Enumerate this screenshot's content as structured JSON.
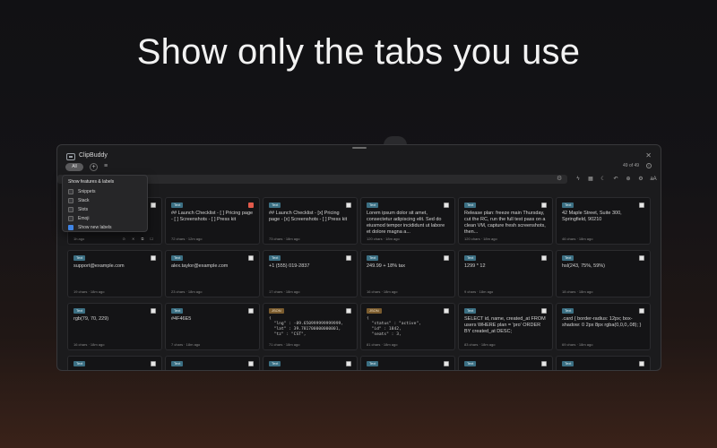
{
  "headline": "Show only the tabs you use",
  "app": {
    "title": "ClipBuddy",
    "filter_label": "All",
    "count": "49 of 49"
  },
  "dropdown": {
    "title": "Show features & labels",
    "items": [
      {
        "label": "Snippets",
        "checked": false
      },
      {
        "label": "Stack",
        "checked": false
      },
      {
        "label": "Slots",
        "checked": false
      },
      {
        "label": "Emoji",
        "checked": false
      },
      {
        "label": "Show new labels",
        "checked": true
      }
    ]
  },
  "cards": [
    {
      "tag": "Text",
      "body": "",
      "meta": "1h ago",
      "check": "white",
      "mono": false,
      "tools": "⊙ ✕ ⧉ ☐"
    },
    {
      "tag": "Text",
      "body": "## Launch Checklist - [ ] Pricing page - [ ] Screenshots - [ ] Press kit",
      "meta": "72 chars · 12m ago",
      "check": "red",
      "mono": false
    },
    {
      "tag": "Text",
      "body": "## Launch Checklist - [x] Pricing page - [x] Screenshots - [ ] Press kit",
      "meta": "73 chars · 18m ago",
      "check": "white",
      "mono": false
    },
    {
      "tag": "Text",
      "body": "Lorem ipsum dolor sit amet, consectetur adipiscing elit. Sed do eiusmod tempor incididunt ut labore et dolore magna a...",
      "meta": "120 chars · 18m ago",
      "check": "white",
      "mono": false
    },
    {
      "tag": "Text",
      "body": "Release plan: freeze main Thursday, cut the RC, run the full test pass on a clean VM, capture fresh screenshots, then...",
      "meta": "120 chars · 18m ago",
      "check": "white",
      "mono": false
    },
    {
      "tag": "Text",
      "body": "42 Maple Street, Suite 300, Springfield, 90210",
      "meta": "46 chars · 18m ago",
      "check": "white",
      "mono": false
    },
    {
      "tag": "Text",
      "body": "support@example.com",
      "meta": "19 chars · 18m ago",
      "check": "white",
      "mono": false
    },
    {
      "tag": "Text",
      "body": "alex.taylor@example.com",
      "meta": "23 chars · 18m ago",
      "check": "white",
      "mono": false
    },
    {
      "tag": "Text",
      "body": "+1 (555) 019-2837",
      "meta": "17 chars · 18m ago",
      "check": "white",
      "mono": false
    },
    {
      "tag": "Text",
      "body": "249.99 + 18% tax",
      "meta": "16 chars · 18m ago",
      "check": "white",
      "mono": false
    },
    {
      "tag": "Text",
      "body": "1299 * 12",
      "meta": "9 chars · 18m ago",
      "check": "white",
      "mono": false
    },
    {
      "tag": "Text",
      "body": "hsl(243, 75%, 59%)",
      "meta": "18 chars · 18m ago",
      "check": "white",
      "mono": false
    },
    {
      "tag": "Text",
      "body": "rgb(79, 70, 229)",
      "meta": "16 chars · 18m ago",
      "check": "white",
      "mono": false
    },
    {
      "tag": "Text",
      "body": "#4F46E5",
      "meta": "7 chars · 18m ago",
      "check": "white",
      "mono": false
    },
    {
      "tag": "JSON",
      "body": "{\n  \"lng\" : -89.650999999999999,\n  \"lat\" : 39.781700000000001,\n  \"tz\" : \"CST\",",
      "meta": "71 chars · 18m ago",
      "check": "white",
      "mono": true
    },
    {
      "tag": "JSON",
      "body": "{\n  \"status\" : \"active\",\n  \"id\" : 1842,\n  \"seats\" : 3,",
      "meta": "81 chars · 18m ago",
      "check": "white",
      "mono": true
    },
    {
      "tag": "Text",
      "body": "SELECT id, name, created_at FROM users WHERE plan = 'pro' ORDER BY created_at DESC;",
      "meta": "83 chars · 18m ago",
      "check": "white",
      "mono": false
    },
    {
      "tag": "Text",
      "body": ".card { border-radius: 12px; box-shadow: 0 2px 8px rgba(0,0,0,.08); }",
      "meta": "69 chars · 18m ago",
      "check": "white",
      "mono": false
    },
    {
      "tag": "Text",
      "body": "",
      "meta": "",
      "check": "white",
      "mono": false
    },
    {
      "tag": "Text",
      "body": "",
      "meta": "",
      "check": "white",
      "mono": false
    },
    {
      "tag": "Text",
      "body": "",
      "meta": "",
      "check": "white",
      "mono": false
    },
    {
      "tag": "Text",
      "body": "",
      "meta": "",
      "check": "white",
      "mono": false
    },
    {
      "tag": "Text",
      "body": "",
      "meta": "",
      "check": "white",
      "mono": false
    },
    {
      "tag": "Text",
      "body": "",
      "meta": "",
      "check": "white",
      "mono": false
    }
  ],
  "icons": {
    "toolbar": [
      "bolt-icon",
      "grid-icon",
      "moon-icon",
      "undo-icon",
      "plus-circle-icon",
      "settings-icon",
      "text-size-icon"
    ]
  },
  "colors": {
    "text_tag": "#3b6f83",
    "json_tag": "#7a5b2e",
    "accent": "#3f84e5"
  }
}
